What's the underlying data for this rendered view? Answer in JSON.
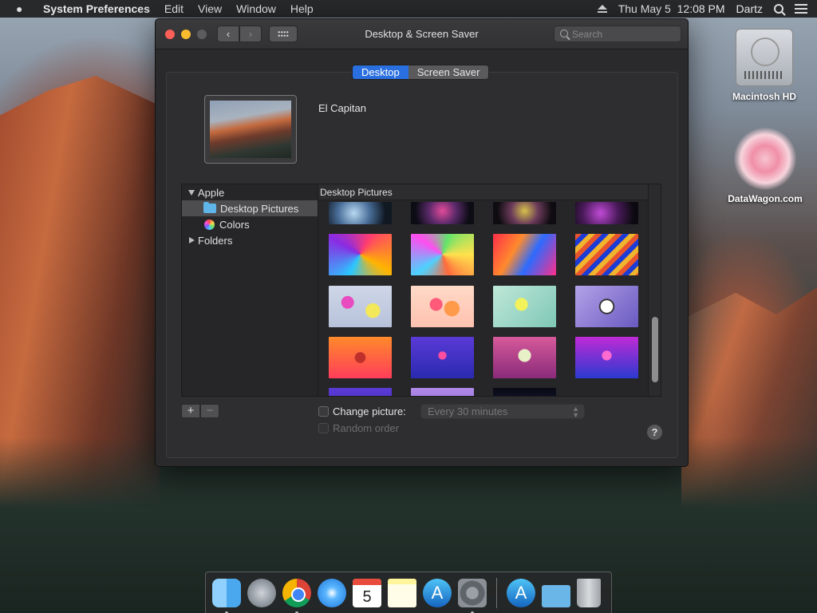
{
  "menubar": {
    "app_name": "System Preferences",
    "menus": [
      "Edit",
      "View",
      "Window",
      "Help"
    ],
    "datetime": "Thu May 5  12:08 PM",
    "user": "Dartz"
  },
  "window": {
    "title": "Desktop & Screen Saver",
    "search_placeholder": "Search",
    "tabs": [
      {
        "label": "Desktop",
        "active": true
      },
      {
        "label": "Screen Saver",
        "active": false
      }
    ],
    "current_picture_name": "El Capitan",
    "sidebar": {
      "items": [
        {
          "label": "Apple"
        },
        {
          "label": "Desktop Pictures"
        },
        {
          "label": "Colors"
        },
        {
          "label": "Folders"
        }
      ]
    },
    "grid_header": "Desktop Pictures",
    "change_picture_label": "Change picture:",
    "interval_value": "Every 30 minutes",
    "random_order_label": "Random order",
    "help_label": "?",
    "add_label": "+",
    "remove_label": "−"
  },
  "desktop_icons": [
    {
      "label": "Macintosh HD"
    },
    {
      "label": "DataWagon.com"
    }
  ],
  "dock": {
    "calendar_day": "5"
  },
  "colors": {
    "accent": "#2a6fe0",
    "window_bg": "#2a2a2c"
  }
}
